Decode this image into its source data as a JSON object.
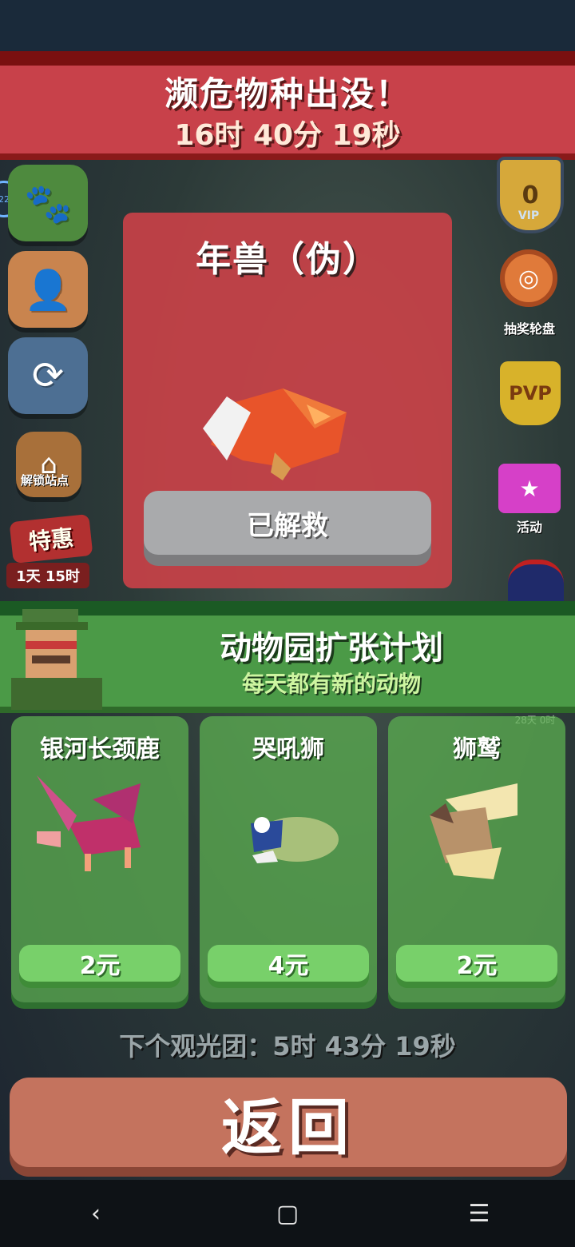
{
  "banner": {
    "title": "濒危物种出没！",
    "timer": "16时 40分 19秒"
  },
  "side_left": {
    "badge": "22",
    "unlock_label": "解锁站点",
    "promo_label": "特惠",
    "promo_time": "1天 15时"
  },
  "side_right": {
    "vip_count": "0",
    "vip_label": "VIP",
    "wheel_label": "抽奖轮盘",
    "pvp_label": "PVP",
    "event_label": "活动"
  },
  "featured": {
    "name": "年兽（伪）",
    "button_label": "已解救"
  },
  "expansion": {
    "title": "动物园扩张计划",
    "subtitle": "每天都有新的动物",
    "timer": "28天 0时"
  },
  "offers": [
    {
      "name": "银河长颈鹿",
      "price": "2元"
    },
    {
      "name": "哭吼狮",
      "price": "4元"
    },
    {
      "name": "狮鹫",
      "price": "2元"
    }
  ],
  "footer": {
    "next_tour": "下个观光团：5时 43分 19秒",
    "back_label": "返回"
  },
  "nav": {
    "back_glyph": "‹",
    "home_glyph": "▢",
    "menu_glyph": "☰"
  },
  "colors": {
    "banner_red": "#c8414a",
    "banner_green": "#4b9a47",
    "back_button": "#c4735e",
    "price_button": "#78d06a"
  }
}
